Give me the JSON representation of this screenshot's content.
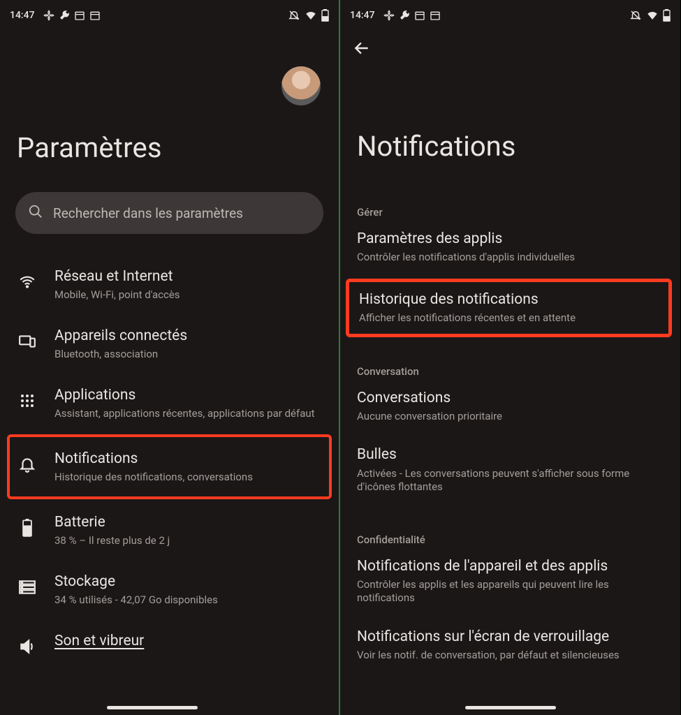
{
  "status": {
    "time": "14:47"
  },
  "left": {
    "title": "Paramètres",
    "search_placeholder": "Rechercher dans les paramètres",
    "items": [
      {
        "title": "Réseau et Internet",
        "sub": "Mobile, Wi-Fi, point d'accès"
      },
      {
        "title": "Appareils connectés",
        "sub": "Bluetooth, association"
      },
      {
        "title": "Applications",
        "sub": "Assistant, applications récentes, applications par défaut"
      },
      {
        "title": "Notifications",
        "sub": "Historique des notifications, conversations"
      },
      {
        "title": "Batterie",
        "sub": "38 % – Il reste plus de 2 j"
      },
      {
        "title": "Stockage",
        "sub": "34 % utilisés - 42,07 Go disponibles"
      },
      {
        "title": "Son et vibreur",
        "sub": ""
      }
    ]
  },
  "right": {
    "title": "Notifications",
    "sections": {
      "manage": "Gérer",
      "conversation": "Conversation",
      "privacy": "Confidentialité"
    },
    "items": {
      "app_settings": {
        "title": "Paramètres des applis",
        "sub": "Contrôler les notifications d'applis individuelles"
      },
      "history": {
        "title": "Historique des notifications",
        "sub": "Afficher les notifications récentes et en attente"
      },
      "conversations": {
        "title": "Conversations",
        "sub": "Aucune conversation prioritaire"
      },
      "bubbles": {
        "title": "Bulles",
        "sub": "Activées - Les conversations peuvent s'afficher sous forme d'icônes flottantes"
      },
      "device_apps": {
        "title": "Notifications de l'appareil et des applis",
        "sub": "Contrôler les applis et les appareils qui peuvent lire les notifications"
      },
      "lockscreen": {
        "title": "Notifications sur l'écran de verrouillage",
        "sub": "Voir les notif. de conversation, par défaut et silencieuses"
      }
    }
  }
}
